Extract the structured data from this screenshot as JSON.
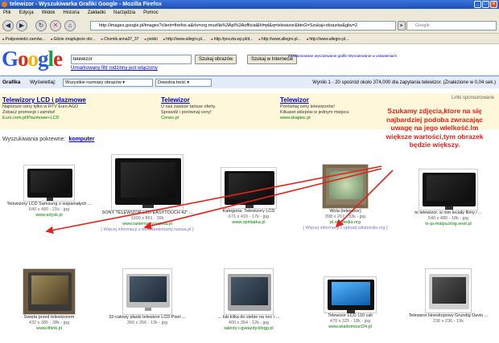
{
  "window": {
    "title": "telewizor - Wyszukiwarka Grafiki Google - Mozilla Firefox"
  },
  "menu": [
    "Plik",
    "Edycja",
    "Widok",
    "Historia",
    "Zakładki",
    "Narzędzia",
    "Pomoc"
  ],
  "nav": {
    "url": "http://images.google.pl/images?client=firefox-a&rls=org.mozilla%3Apl%3Aofficial&hl=pl&q=telewizor&btnG=Szukaj+obrazów&gbv=2",
    "search_placeholder": "Google"
  },
  "bookmarks": [
    "Podpowiedzi zamów...",
    "Gdzie znajdujecie obr...",
    "Chomik.anna37_37",
    "polski",
    "http://www.allegro.pl...",
    "http://poczta.wp.pl/d...",
    "http://www.allegro.pl...",
    "http://www.allegro.pl..."
  ],
  "search": {
    "logo": "Google",
    "query": "telewizor",
    "btn_images": "Szukaj obrazów",
    "btn_web": "Szukaj w Internecie",
    "filter_link": "Umiarkowany filtr rodzinny jest włączony",
    "adv_links": "Zaawansowane wyszukiwanie grafiki\nWyszukiwanie w ustawieniach"
  },
  "resultbar": {
    "label": "Grafika",
    "show_label": "Wyświetlaj:",
    "size_select": "Wszystkie rozmiary obrazów",
    "content_select": "Dowolna treść",
    "stats": "Wyniki 1 - 20 spośród około 374,000 dla zapytania telewizor. (Znalezione w 0,04 sek.)"
  },
  "ads": {
    "label": "Linki sponsorowane",
    "items": [
      {
        "title": "Telewizory LCD i plazmowe",
        "l1": "Najniższe ceny tylko w RTV Euro AGD",
        "l2": "Zobacz promocje i zamów!",
        "url": "Euro.com.pl/Plazmowe+LCD"
      },
      {
        "title": "Telewizor",
        "l1": "U nas zawsze tańsze oferty.",
        "l2": "Sprawdź i porównaj ceny!",
        "url": "Ceneo.pl"
      },
      {
        "title": "Telewizor",
        "l1": "Porównaj ceny telewizorów!",
        "l2": "Kilkaset sklepów w jednym miejscu",
        "url": "www.skapiec.pl"
      }
    ]
  },
  "related": {
    "label": "Wyszukiwania pokrewne:",
    "link": "komputer"
  },
  "annotation": "Szukamy zdjęcia,ktore na się najbardziej podoba zwracając uwagę na jego wielkość.Im większe wartości,tym obrazek będzie większy.",
  "results": [
    {
      "title": "Telewizory LCD Samsung o wspaniałych ...",
      "dims": "640 x 480 - 21k - jpg",
      "domain": "www.edysk.pl",
      "similar": ""
    },
    {
      "title": "SONY TELEWIZOR LCD EASYTOUCH 42\" ...",
      "dims": "1000 x 861 - 39k",
      "domain": "www.taniemarty.nazwa.pl",
      "similar": "[ Więcej informacji z www.taniemarty.nazwa.pl ]"
    },
    {
      "title": "Kategoria: Telewizory LCD",
      "dims": "671 x 410 - 17k - jpg",
      "domain": "www.opiniarka.pl",
      "similar": ""
    },
    {
      "title": "Wola (telewizor)",
      "dims": "398 x 267 - 33k - jpg",
      "domain": "pl.wikipedia.org",
      "similar": "[ Więcej informacji z upload.wikimedia.org ]"
    },
    {
      "title": "to telewizor, w nim leciały filmy i ...",
      "dims": "640 x 480 - 18k - jpg",
      "domain": "to-ja-malpa.blog.onet.pl",
      "similar": ""
    },
    {
      "title": "Święta przed telewizorem",
      "dims": "432 x 385 - 38k - jpg",
      "domain": "www.ithink.pl",
      "similar": ""
    },
    {
      "title": "32-calowy płaski telewizor LCD Pixel ...",
      "dims": "356 x 356 - 13k - jpg",
      "domain": "",
      "similar": ""
    },
    {
      "title": "... lub kilka do siebie na noc i ...",
      "dims": "400 x 354 - 12k - jpg",
      "domain": "talenty-i-gwiazdy.blogg.pl",
      "similar": ""
    },
    {
      "title": "Telewizor LCD 110 cali",
      "dims": "470 x 325 - 18k - jpg",
      "domain": "www.wiadomosci24.pl",
      "similar": ""
    },
    {
      "title": "Telewizor kineskopowy Grundig Davio ...",
      "dims": "236 x 236 - 19k",
      "domain": "",
      "similar": ""
    }
  ]
}
